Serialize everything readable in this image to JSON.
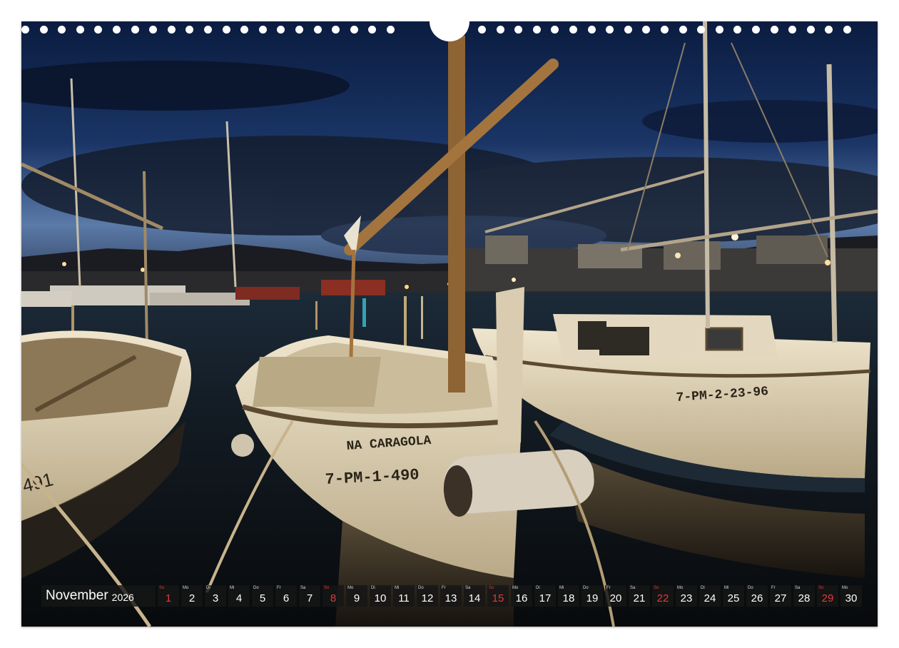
{
  "calendar": {
    "month": "November",
    "year": "2026",
    "days": [
      {
        "wd": "So",
        "d": "1",
        "sunday": true
      },
      {
        "wd": "Mo",
        "d": "2",
        "sunday": false
      },
      {
        "wd": "Di",
        "d": "3",
        "sunday": false
      },
      {
        "wd": "Mi",
        "d": "4",
        "sunday": false
      },
      {
        "wd": "Do",
        "d": "5",
        "sunday": false
      },
      {
        "wd": "Fr",
        "d": "6",
        "sunday": false
      },
      {
        "wd": "Sa",
        "d": "7",
        "sunday": false
      },
      {
        "wd": "So",
        "d": "8",
        "sunday": true
      },
      {
        "wd": "Mo",
        "d": "9",
        "sunday": false
      },
      {
        "wd": "Di",
        "d": "10",
        "sunday": false
      },
      {
        "wd": "Mi",
        "d": "11",
        "sunday": false
      },
      {
        "wd": "Do",
        "d": "12",
        "sunday": false
      },
      {
        "wd": "Fr",
        "d": "13",
        "sunday": false
      },
      {
        "wd": "Sa",
        "d": "14",
        "sunday": false
      },
      {
        "wd": "So",
        "d": "15",
        "sunday": true
      },
      {
        "wd": "Mo",
        "d": "16",
        "sunday": false
      },
      {
        "wd": "Di",
        "d": "17",
        "sunday": false
      },
      {
        "wd": "Mi",
        "d": "18",
        "sunday": false
      },
      {
        "wd": "Do",
        "d": "19",
        "sunday": false
      },
      {
        "wd": "Fr",
        "d": "20",
        "sunday": false
      },
      {
        "wd": "Sa",
        "d": "21",
        "sunday": false
      },
      {
        "wd": "So",
        "d": "22",
        "sunday": true
      },
      {
        "wd": "Mo",
        "d": "23",
        "sunday": false
      },
      {
        "wd": "Di",
        "d": "24",
        "sunday": false
      },
      {
        "wd": "Mi",
        "d": "25",
        "sunday": false
      },
      {
        "wd": "Do",
        "d": "26",
        "sunday": false
      },
      {
        "wd": "Fr",
        "d": "27",
        "sunday": false
      },
      {
        "wd": "Sa",
        "d": "28",
        "sunday": false
      },
      {
        "wd": "So",
        "d": "29",
        "sunday": true
      },
      {
        "wd": "Mo",
        "d": "30",
        "sunday": false
      }
    ]
  },
  "photo": {
    "boat_name": "NA CARAGOLA",
    "boat_registration_center": "7-PM-1-490",
    "boat_registration_right": "7-PM-2-23-96",
    "boat_registration_left": "491"
  },
  "colors": {
    "sunday": "#e23a3a",
    "bar_background": "#161616",
    "sky_top": "#0d1f45",
    "hull": "#e6dcc4"
  }
}
